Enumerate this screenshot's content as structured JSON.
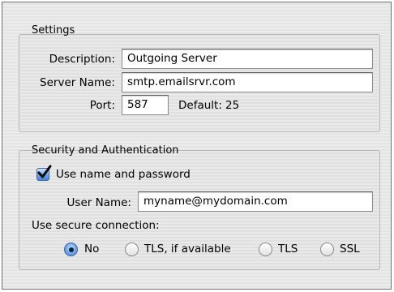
{
  "settings": {
    "title": "Settings",
    "description_label": "Description:",
    "description_value": "Outgoing Server",
    "server_name_label": "Server Name:",
    "server_name_value": "smtp.emailsrvr.com",
    "port_label": "Port:",
    "port_value": "587",
    "default_label": "Default:",
    "default_value": "25"
  },
  "security": {
    "title": "Security and Authentication",
    "use_name_password_label": "Use name and password",
    "use_name_password_checked": true,
    "user_name_label": "User Name:",
    "user_name_value": "myname@mydomain.com",
    "secure_connection_label": "Use secure connection:",
    "options": [
      {
        "label": "No",
        "selected": true
      },
      {
        "label": "TLS, if available",
        "selected": false
      },
      {
        "label": "TLS",
        "selected": false
      },
      {
        "label": "SSL",
        "selected": false
      }
    ]
  },
  "colors": {
    "accent": "#4b86d6",
    "checkmark": "#0a0a0a"
  }
}
